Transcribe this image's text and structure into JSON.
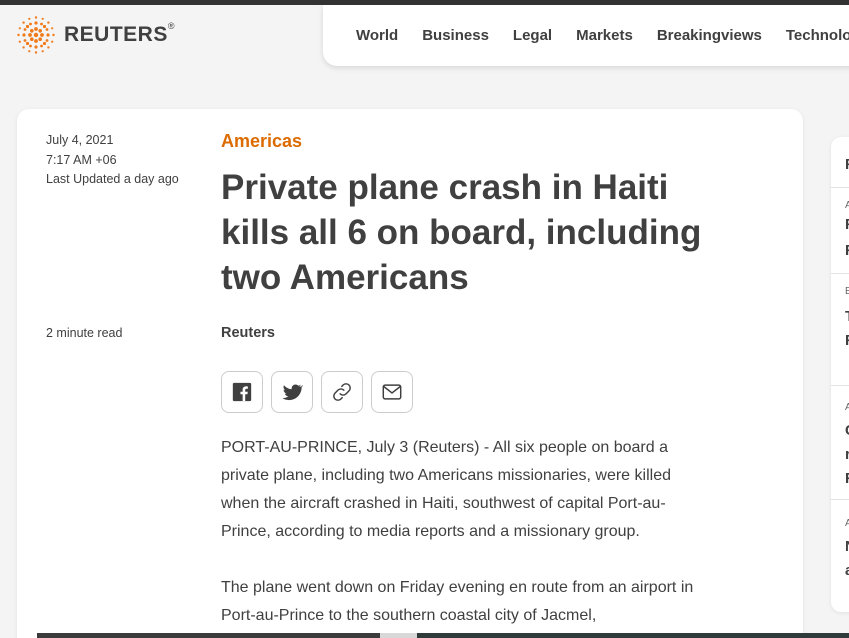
{
  "brand": {
    "name": "REUTERS",
    "registered": "®"
  },
  "nav": {
    "items": [
      "World",
      "Business",
      "Legal",
      "Markets",
      "Breakingviews",
      "Technology"
    ]
  },
  "article": {
    "date": "July 4, 2021",
    "time": "7:17 AM +06",
    "updated": "Last Updated a day ago",
    "read_time": "2 minute read",
    "section": "Americas",
    "headline": "Private plane crash in Haiti kills all 6 on board, including two Americans",
    "byline": "Reuters",
    "paragraphs": [
      "PORT-AU-PRINCE, July 3 (Reuters) - All six people on board a private plane, including two Americans missionaries, were killed when the aircraft crashed in Haiti, southwest of capital Port-au-Prince, according to media reports and a missionary group.",
      "The plane went down on Friday evening en route from an airport in Port-au-Prince to the southern coastal city of Jacmel,"
    ]
  },
  "share": {
    "icons": [
      "facebook-icon",
      "twitter-icon",
      "link-icon",
      "email-icon"
    ]
  },
  "sidebar": {
    "heading": "R",
    "items": [
      {
        "tag": "A",
        "lines": [
          "F",
          "F"
        ]
      },
      {
        "tag": "E",
        "lines": [
          "T",
          "F"
        ]
      },
      {
        "tag": "A",
        "lines": [
          "C",
          "r",
          "F"
        ]
      },
      {
        "tag": "A",
        "lines": [
          "N",
          "a"
        ]
      }
    ]
  },
  "colors": {
    "accent": "#dc6b00",
    "text": "#404040",
    "background": "#f4f4f4"
  }
}
